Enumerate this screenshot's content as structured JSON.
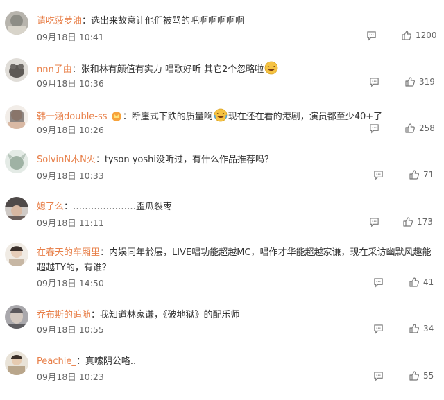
{
  "comments": [
    {
      "user": "请吃菠萝油",
      "sep": "：",
      "text": "选出来故意让他们被骂的吧啊啊啊啊啊",
      "time": "09月18日 10:41",
      "likes": "1200",
      "avatar_color": "#8d8d86"
    },
    {
      "user": "nnn子由",
      "sep": "：",
      "text": "张和林有颜值有实力 唱歌好听 其它2个忽略啦",
      "time": "09月18日 10:36",
      "likes": "319",
      "avatar_color": "#6e6a66"
    },
    {
      "user": "韩一涵double-ss",
      "sep": "：",
      "text_a": "断崖式下跌的质量啊",
      "text_b": "现在还在看的港剧，演员都至少40+了",
      "time": "09月18日 10:26",
      "likes": "258",
      "avatar_color": "#d9b9a4"
    },
    {
      "user": "SolvinN木N火",
      "sep": "：",
      "text": "tyson yoshi没听过，有什么作品推荐吗？",
      "time": "09月18日 10:33",
      "likes": "71",
      "avatar_color": "#9fb2a4"
    },
    {
      "user": "媳了么",
      "sep": "：",
      "text": "…………………歪瓜裂枣",
      "time": "09月18日 11:11",
      "likes": "173",
      "avatar_color": "#4f4a49"
    },
    {
      "user": "在春天的车厢里",
      "sep": "：",
      "text": "内娱同年龄层，LIVE唱功能超越MC，唱作才华能超越家谦，现在采访幽默风趣能超越TY的，有谁？",
      "time": "09月18日 14:50",
      "likes": "41",
      "avatar_color": "#c7b7a4"
    },
    {
      "user": "乔布斯的追随",
      "sep": "：",
      "text": "我知道林家谦，《破地狱》的配乐师",
      "time": "09月18日 10:55",
      "likes": "34",
      "avatar_color": "#8f8e91"
    },
    {
      "user": "Peachie_",
      "sep": "：",
      "text": "真嗦阴公咯..",
      "time": "09月18日 10:23",
      "likes": "55",
      "avatar_color": "#b9a68b"
    }
  ],
  "icons": {
    "reply": "comment-icon",
    "like": "thumbs-up-icon",
    "emoji": "laughing-emoji-icon",
    "badge": "crown-badge-icon"
  }
}
